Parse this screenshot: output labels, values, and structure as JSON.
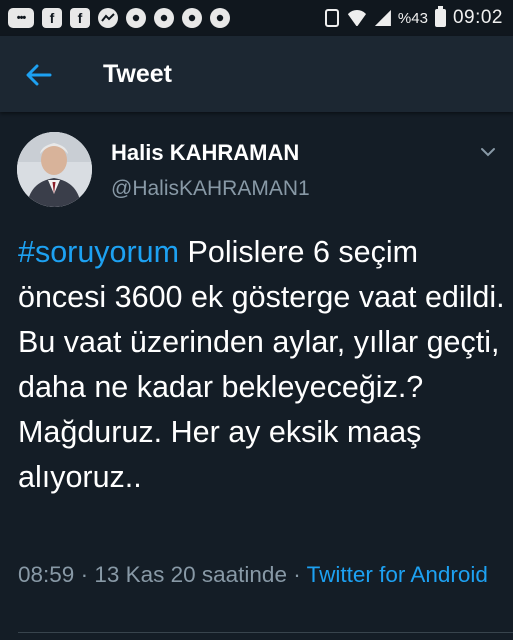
{
  "status_bar": {
    "icons": [
      "message-icon",
      "facebook-icon",
      "facebook-icon",
      "messenger-icon",
      "chrome-icon",
      "chrome-icon",
      "chrome-icon",
      "chrome-icon"
    ],
    "fb_glyph": "f",
    "battery_percent": "%43",
    "time": "09:02"
  },
  "header": {
    "back_icon": "arrow-left-icon",
    "title": "Tweet"
  },
  "tweet": {
    "author": {
      "display_name": "Halis KAHRAMAN",
      "handle": "@HalisKAHRAMAN1"
    },
    "hashtag": "#soruyorum",
    "text": " Polislere 6 seçim öncesi 3600 ek gösterge vaat edildi. Bu vaat üzerinden aylar, yıllar geçti, daha ne kadar bekleyeceğiz.? Mağduruz. Her ay eksik maaş alıyoruz..",
    "time": "08:59",
    "separator": " · ",
    "date": "13 Kas 20 saatinde",
    "source": "Twitter for Android"
  },
  "colors": {
    "background": "#141d26",
    "app_bar": "#1c2732",
    "accent": "#1da1f2",
    "secondary_text": "#8899a6"
  }
}
